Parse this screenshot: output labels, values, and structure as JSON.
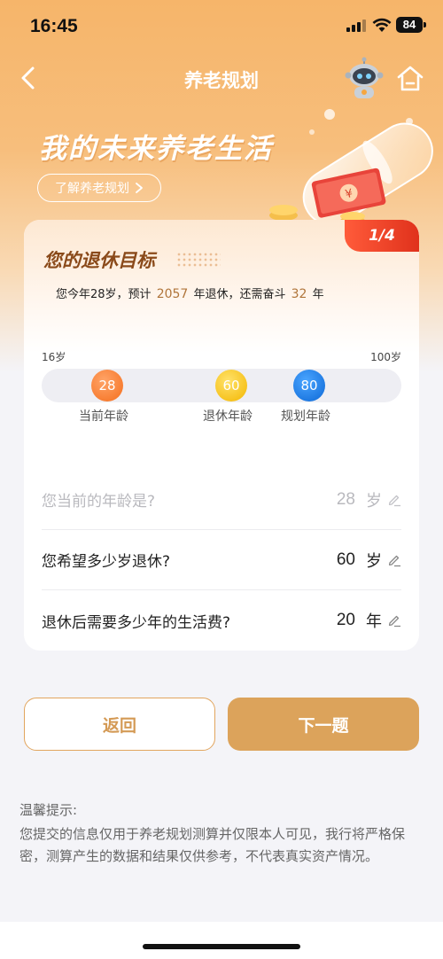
{
  "status_bar": {
    "time": "16:45",
    "battery": "84"
  },
  "nav": {
    "title": "养老规划",
    "back_icon": "chevron-left-icon",
    "assistant_icon": "robot-icon",
    "home_icon": "home-icon"
  },
  "hero": {
    "title": "我的未来养老生活",
    "learn_link": "了解养老规划"
  },
  "card": {
    "step": "1/4",
    "title": "您的退休目标",
    "summary": {
      "prefix": "您今年28岁，预计",
      "retire_year": "2057",
      "middle": "年退休，还需奋斗",
      "years_left": "32",
      "suffix": "年"
    },
    "age_range": {
      "min_label": "16岁",
      "max_label": "100岁",
      "min": 16,
      "max": 100
    },
    "markers": [
      {
        "value": "28",
        "label": "当前年龄",
        "color": "#f56e1c"
      },
      {
        "value": "60",
        "label": "退休年龄",
        "color": "#f3b600"
      },
      {
        "value": "80",
        "label": "规划年龄",
        "color": "#0d68d6"
      }
    ],
    "questions": [
      {
        "question": "您当前的年龄是?",
        "value": "28",
        "unit": "岁",
        "disabled": true
      },
      {
        "question": "您希望多少岁退休?",
        "value": "60",
        "unit": "岁",
        "disabled": false
      },
      {
        "question": "退休后需要多少年的生活费?",
        "value": "20",
        "unit": "年",
        "disabled": false
      }
    ]
  },
  "actions": {
    "back_label": "返回",
    "next_label": "下一题"
  },
  "tips": {
    "label": "温馨提示:",
    "text": "您提交的信息仅用于养老规划测算并仅限本人可见，我行将严格保密，测算产生的数据和结果仅供参考，不代表真实资产情况。"
  },
  "colors": {
    "accent": "#dca35b",
    "badge": "#e0321c",
    "title_brown": "#8a4a1a"
  }
}
